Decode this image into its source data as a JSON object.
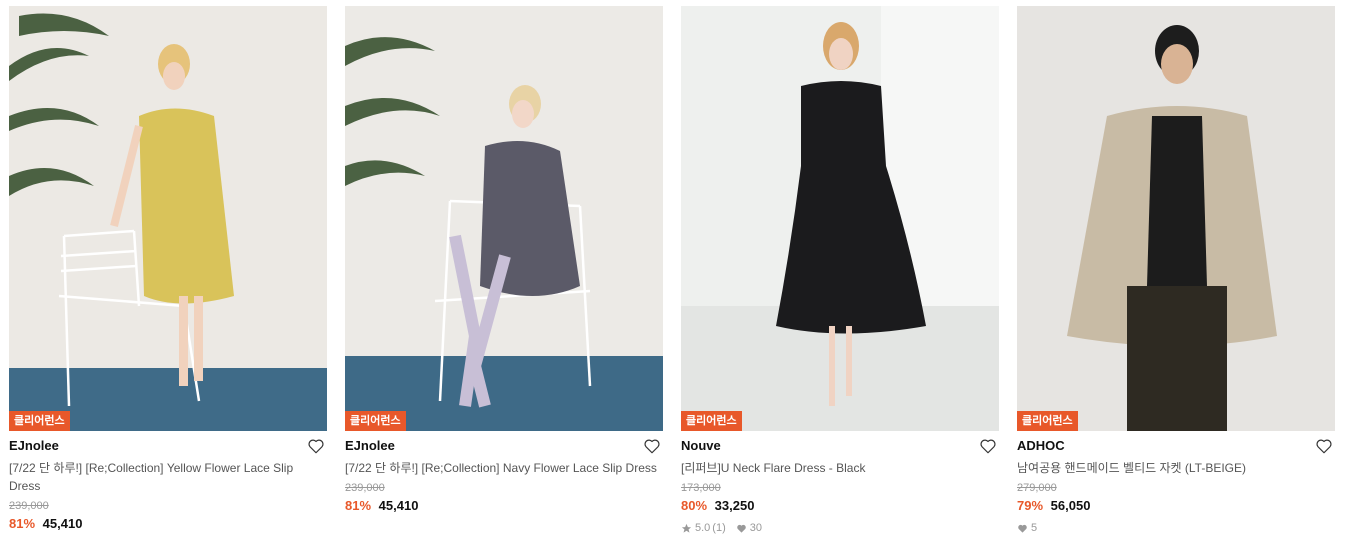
{
  "products": [
    {
      "badge": "클리어런스",
      "brand": "EJnolee",
      "title": "[7/22 단 하루!] [Re;Collection] Yellow Flower Lace Slip Dress",
      "original_price": "239,000",
      "discount": "81%",
      "price": "45,410"
    },
    {
      "badge": "클리어런스",
      "brand": "EJnolee",
      "title": "[7/22 단 하루!] [Re;Collection] Navy Flower Lace Slip Dress",
      "original_price": "239,000",
      "discount": "81%",
      "price": "45,410"
    },
    {
      "badge": "클리어런스",
      "brand": "Nouve",
      "title": "[리퍼브]U Neck Flare Dress - Black",
      "original_price": "173,000",
      "discount": "80%",
      "price": "33,250",
      "rating": "5.0",
      "reviews": "(1)",
      "likes": "30"
    },
    {
      "badge": "클리어런스",
      "brand": "ADHOC",
      "title": "남여공용 핸드메이드 벨티드 자켓 (LT-BEIGE)",
      "original_price": "279,000",
      "discount": "79%",
      "price": "56,050",
      "likes": "5"
    }
  ],
  "icons": {
    "wishlist": "heart-outline-icon",
    "rating": "star-icon",
    "likes": "heart-filled-icon"
  },
  "colors": {
    "accent": "#e8582a",
    "muted": "#999999"
  }
}
